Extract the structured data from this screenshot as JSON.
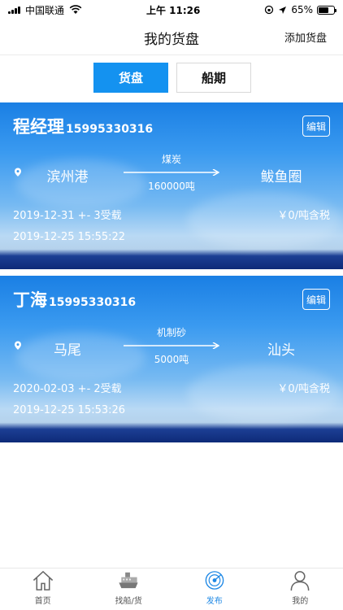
{
  "status_bar": {
    "carrier": "中国联通",
    "time": "上午 11:26",
    "battery": "65%",
    "battery_level": 0.65
  },
  "nav": {
    "title": "我的货盘",
    "action": "添加货盘"
  },
  "segments": [
    {
      "label": "货盘",
      "active": true
    },
    {
      "label": "船期",
      "active": false
    }
  ],
  "cards": [
    {
      "name": "程经理",
      "phone": "15995330316",
      "edit": "编辑",
      "from": "滨州港",
      "to": "鲅鱼圈",
      "cargo": "煤炭",
      "tonnage": "160000吨",
      "load_window": "2019-12-31 +- 3受载",
      "price": "￥0/吨含税",
      "posted": "2019-12-25 15:55:22"
    },
    {
      "name": "丁海",
      "phone": "15995330316",
      "edit": "编辑",
      "from": "马尾",
      "to": "汕头",
      "cargo": "机制砂",
      "tonnage": "5000吨",
      "load_window": "2020-02-03 +- 2受载",
      "price": "￥0/吨含税",
      "posted": "2019-12-25 15:53:26"
    }
  ],
  "tabs": [
    {
      "label": "首页",
      "icon": "home-icon"
    },
    {
      "label": "找船/货",
      "icon": "ship-icon"
    },
    {
      "label": "发布",
      "icon": "publish-icon",
      "active": true
    },
    {
      "label": "我的",
      "icon": "user-icon"
    }
  ],
  "colors": {
    "accent": "#1492f0",
    "tab_active": "#1e88e5"
  }
}
